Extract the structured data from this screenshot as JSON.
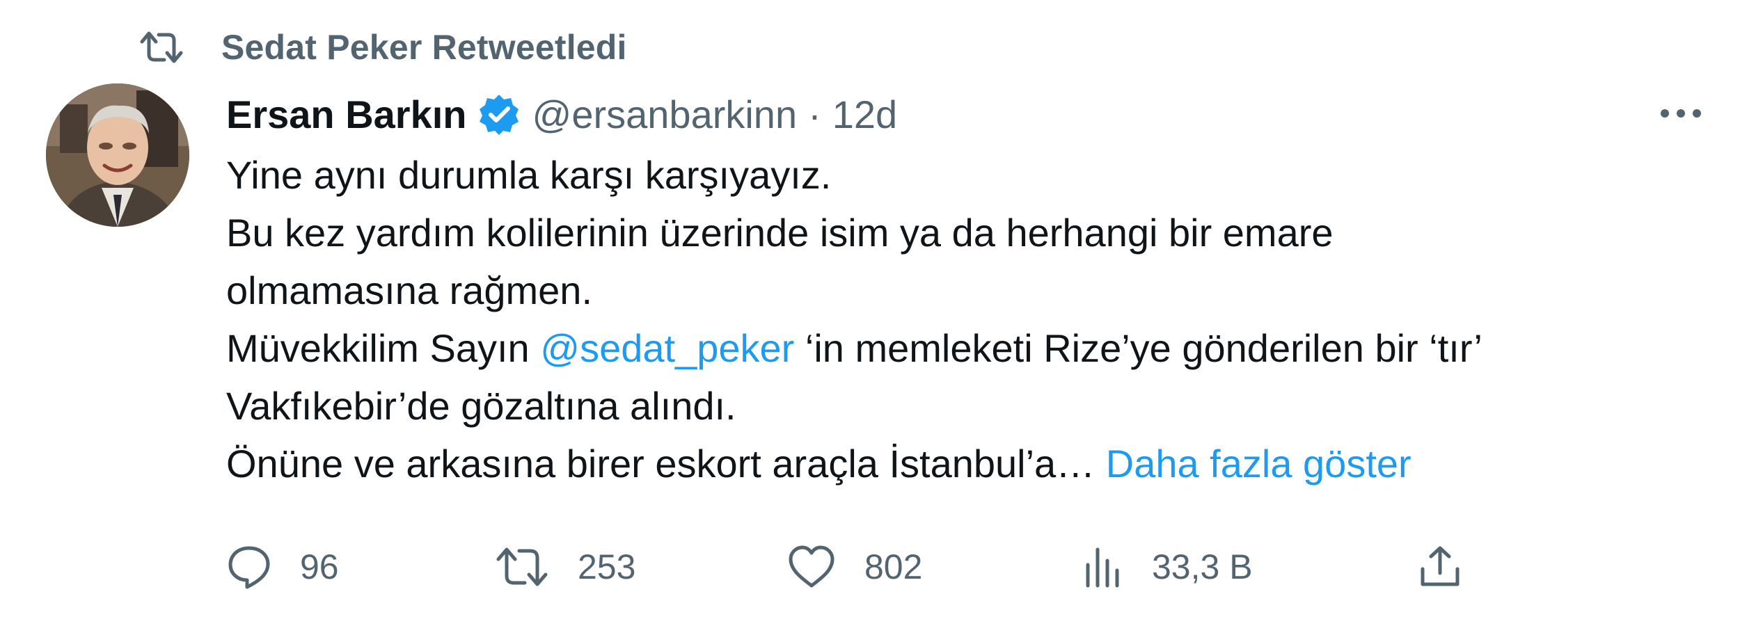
{
  "retweet": {
    "label": "Sedat Peker Retweetledi"
  },
  "author": {
    "name": "Ersan Barkın",
    "handle": "@ersanbarkinn",
    "separator": "·",
    "time": "12d"
  },
  "body": {
    "line1": "Yine aynı durumla karşı karşıyayız.",
    "line2": "Bu kez yardım kolilerinin üzerinde isim ya da herhangi bir emare",
    "line3": "olmamasına rağmen.",
    "line4_pre": "Müvekkilim Sayın ",
    "line4_mention": "@sedat_peker",
    "line4_post": " ‘in memleketi Rize’ye gönderilen bir ‘tır’",
    "line5": "Vakfıkebir’de gözaltına alındı.",
    "line6": "Önüne ve arkasına birer eskort araçla İstanbul’a…",
    "show_more": "Daha fazla göster"
  },
  "actions": {
    "replies": "96",
    "retweets": "253",
    "likes": "802",
    "views": "33,3 B"
  },
  "icons": {
    "retweet": "retweet-icon",
    "verified": "verified-badge-icon",
    "more": "more-dots-icon",
    "reply": "reply-icon",
    "like": "heart-icon",
    "views": "views-chart-icon",
    "share": "share-icon"
  },
  "colors": {
    "text": "#0f1419",
    "secondary": "#536471",
    "link": "#1d9bf0",
    "verified": "#1d9bf0"
  }
}
